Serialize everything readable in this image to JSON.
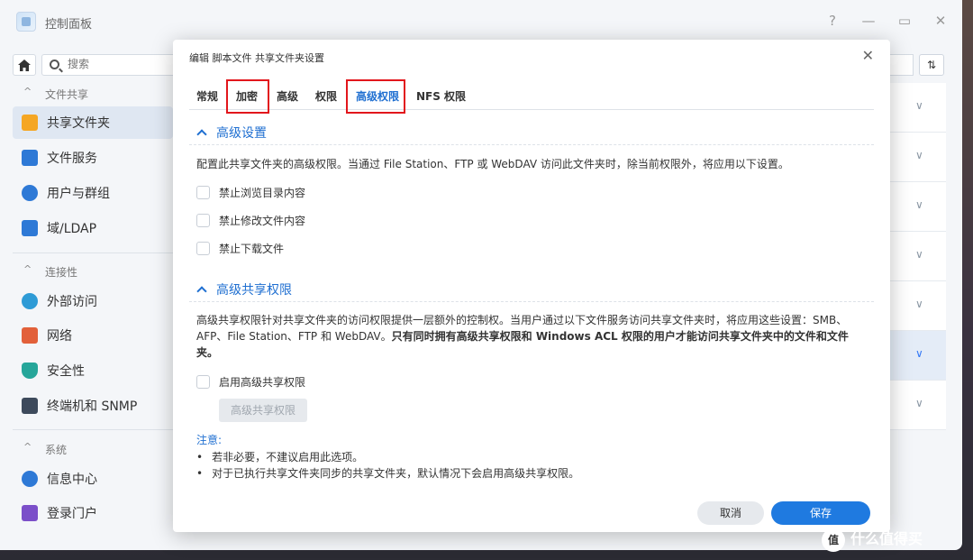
{
  "window": {
    "title": "控制面板"
  },
  "sidebar": {
    "search_placeholder": "搜索",
    "sections": [
      {
        "label": "文件共享",
        "items": [
          {
            "label": "共享文件夹",
            "icon": "folder-icon",
            "color": "#f5a623",
            "active": true
          },
          {
            "label": "文件服务",
            "icon": "file-service-icon",
            "color": "#2e79d6"
          },
          {
            "label": "用户与群组",
            "icon": "users-icon",
            "color": "#2e79d6"
          },
          {
            "label": "域/LDAP",
            "icon": "domain-icon",
            "color": "#2e79d6"
          }
        ]
      },
      {
        "label": "连接性",
        "items": [
          {
            "label": "外部访问",
            "icon": "external-access-icon",
            "color": "#2e9bd6"
          },
          {
            "label": "网络",
            "icon": "network-icon",
            "color": "#e2603a"
          },
          {
            "label": "安全性",
            "icon": "shield-icon",
            "color": "#26a69a"
          },
          {
            "label": "终端机和 SNMP",
            "icon": "terminal-icon",
            "color": "#3d4a5c"
          }
        ]
      },
      {
        "label": "系统",
        "items": [
          {
            "label": "信息中心",
            "icon": "info-icon",
            "color": "#2e79d6"
          },
          {
            "label": "登录门户",
            "icon": "login-portal-icon",
            "color": "#7b4fc9"
          }
        ]
      }
    ]
  },
  "dialog": {
    "title": "编辑 脚本文件 共享文件夹设置",
    "tabs": [
      "常规",
      "加密",
      "高级",
      "权限",
      "高级权限",
      "NFS 权限"
    ],
    "active_tab": "高级权限",
    "section1": {
      "title": "高级设置",
      "desc": "配置此共享文件夹的高级权限。当通过 File Station、FTP 或 WebDAV 访问此文件夹时，除当前权限外，将应用以下设置。",
      "options": [
        "禁止浏览目录内容",
        "禁止修改文件内容",
        "禁止下载文件"
      ]
    },
    "section2": {
      "title": "高级共享权限",
      "desc_plain": "高级共享权限针对共享文件夹的访问权限提供一层额外的控制权。当用户通过以下文件服务访问共享文件夹时，将应用这些设置：SMB、AFP、File Station、FTP 和 WebDAV。",
      "desc_bold": "只有同时拥有高级共享权限和 Windows ACL 权限的用户才能访问共享文件夹中的文件和文件夹。",
      "enable_label": "启用高级共享权限",
      "button_label": "高级共享权限"
    },
    "note": {
      "title": "注意:",
      "items": [
        "若非必要，不建议启用此选项。",
        "对于已执行共享文件夹同步的共享文件夹，默认情况下会启用高级共享权限。"
      ]
    },
    "cancel_label": "取消",
    "save_label": "保存"
  },
  "watermark": {
    "badge": "值",
    "text": "什么值得买"
  }
}
